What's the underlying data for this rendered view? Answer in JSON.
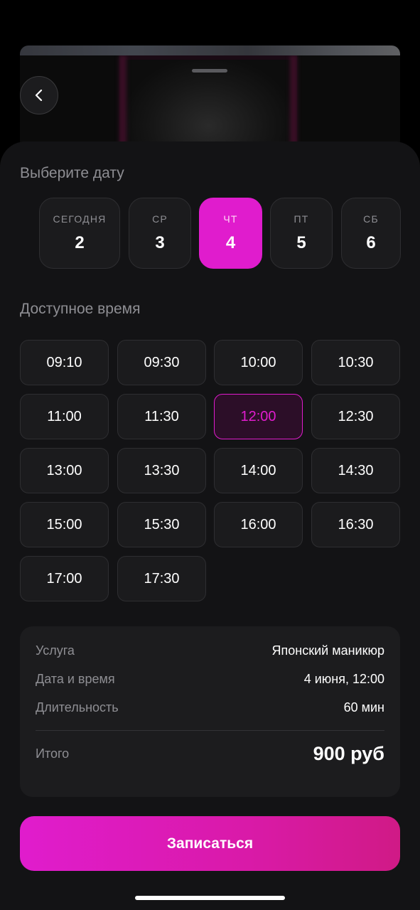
{
  "header": {
    "back_icon": "chevron-left-icon"
  },
  "date_section": {
    "title": "Выберите дату",
    "days": [
      {
        "dow": "СЕГОДНЯ",
        "num": "2",
        "selected": false
      },
      {
        "dow": "СР",
        "num": "3",
        "selected": false
      },
      {
        "dow": "ЧТ",
        "num": "4",
        "selected": true
      },
      {
        "dow": "ПТ",
        "num": "5",
        "selected": false
      },
      {
        "dow": "СБ",
        "num": "6",
        "selected": false
      }
    ]
  },
  "time_section": {
    "title": "Доступное время",
    "slots": [
      "09:10",
      "09:30",
      "10:00",
      "10:30",
      "11:00",
      "11:30",
      "12:00",
      "12:30",
      "13:00",
      "13:30",
      "14:00",
      "14:30",
      "15:00",
      "15:30",
      "16:00",
      "16:30",
      "17:00",
      "17:30"
    ],
    "selected": "12:00"
  },
  "summary": {
    "service_label": "Услуга",
    "service_value": "Японский маникюр",
    "datetime_label": "Дата и время",
    "datetime_value": "4 июня, 12:00",
    "duration_label": "Длительность",
    "duration_value": "60 мин",
    "total_label": "Итого",
    "total_value": "900 руб"
  },
  "cta": {
    "label": "Записаться"
  },
  "colors": {
    "accent": "#e01ccd",
    "background": "#131315",
    "card": "#1b1b1d",
    "muted_text": "#8e8e93"
  }
}
